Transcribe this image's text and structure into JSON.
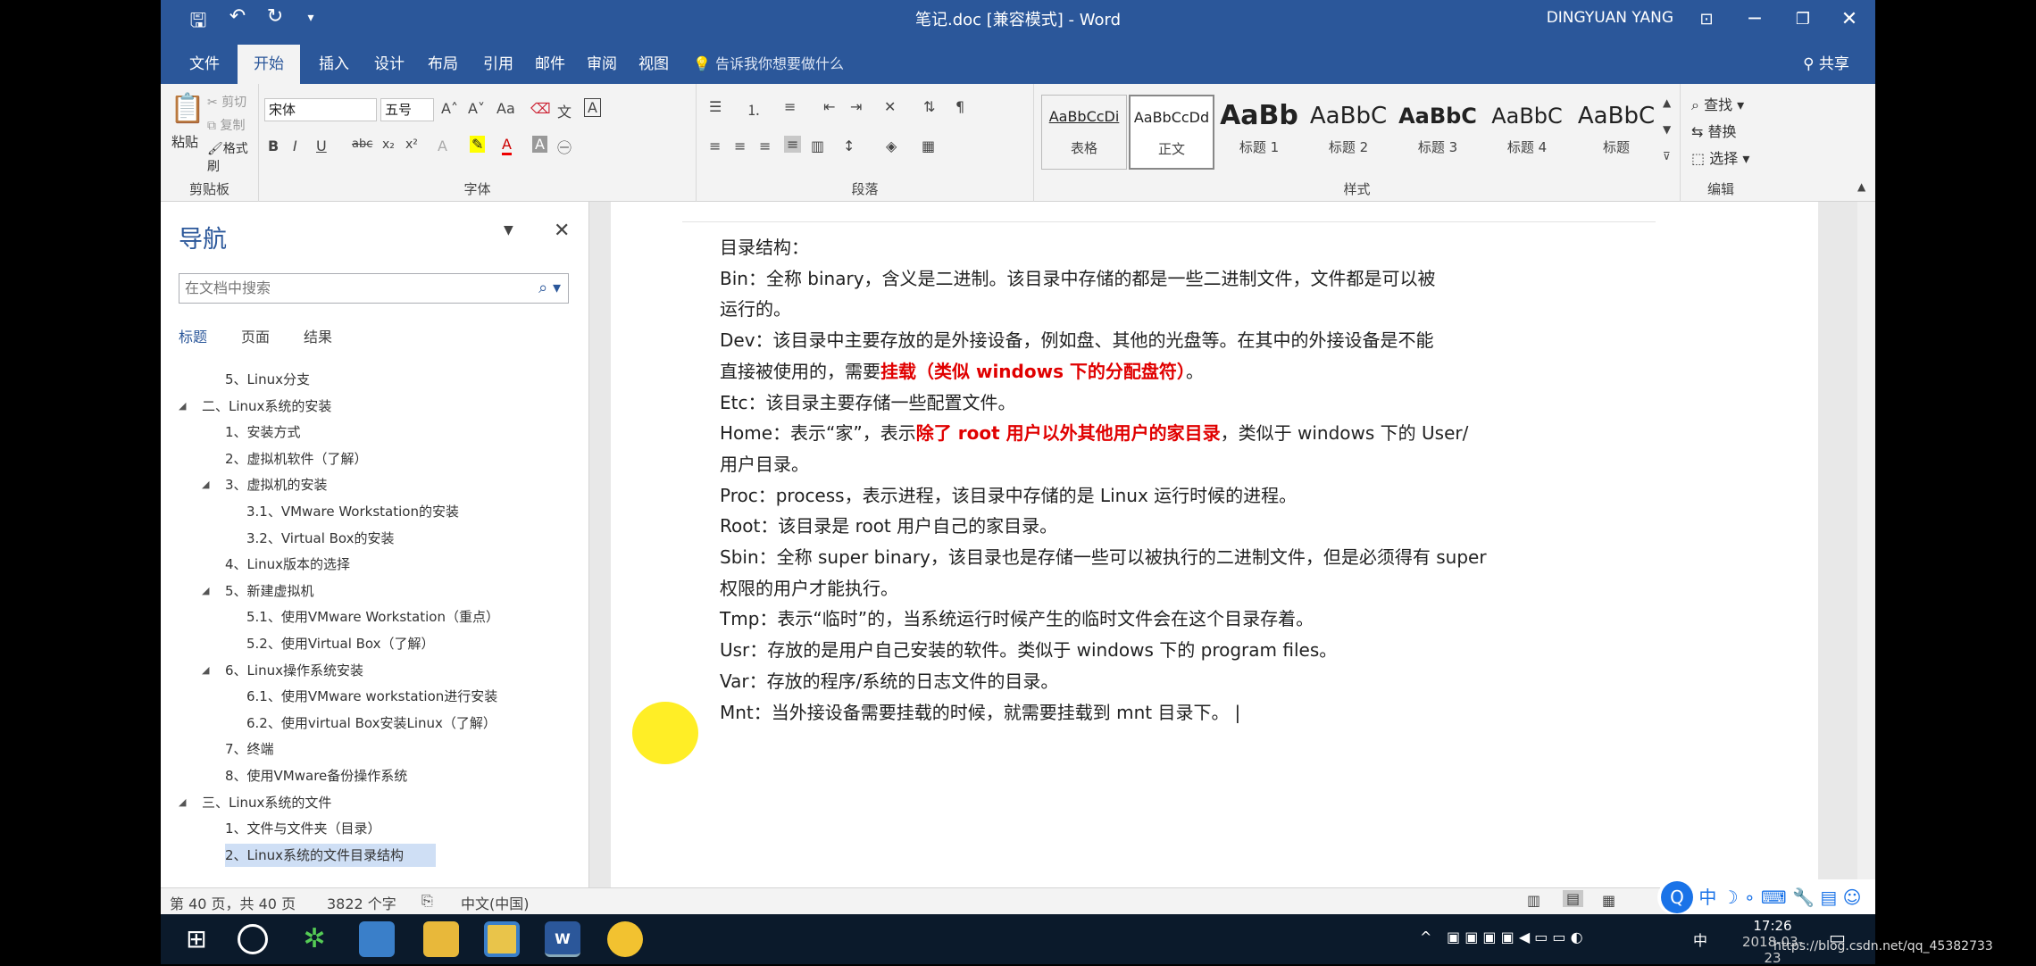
{
  "titlebar": {
    "title": "笔记.doc [兼容模式]  -  Word",
    "user": "DINGYUAN YANG",
    "qat": {
      "save_icon": "save-icon",
      "undo_icon": "undo-icon",
      "redo_icon": "redo-icon"
    }
  },
  "tabs": [
    "文件",
    "开始",
    "插入",
    "设计",
    "布局",
    "引用",
    "邮件",
    "审阅",
    "视图"
  ],
  "tellme": "告诉我你想要做什么",
  "share": "共享",
  "ribbon": {
    "clipboard": {
      "paste": "粘贴",
      "cut": "剪切",
      "copy": "复制",
      "format_painter": "格式刷",
      "label": "剪贴板"
    },
    "font": {
      "name": "宋体",
      "size": "五号",
      "label": "字体",
      "aa": "Aa"
    },
    "paragraph": {
      "label": "段落"
    },
    "styles": {
      "label": "样式",
      "items": [
        {
          "preview": "AaBbCcDi",
          "name": "表格"
        },
        {
          "preview": "AaBbCcDd",
          "name": "正文"
        },
        {
          "preview": "AaBb",
          "name": "标题 1"
        },
        {
          "preview": "AaBbC",
          "name": "标题 2"
        },
        {
          "preview": "AaBbC",
          "name": "标题 3"
        },
        {
          "preview": "AaBbC",
          "name": "标题 4"
        },
        {
          "preview": "AaBbC",
          "name": "标题"
        }
      ]
    },
    "editing": {
      "find": "查找",
      "replace": "替换",
      "select": "选择",
      "label": "编辑"
    }
  },
  "nav": {
    "title": "导航",
    "search_placeholder": "在文档中搜索",
    "tabs": [
      "标题",
      "页面",
      "结果"
    ],
    "items": [
      {
        "text": "5、Linux分支",
        "level": 2,
        "expanded": null
      },
      {
        "text": "二、Linux系统的安装",
        "level": 1,
        "expanded": true
      },
      {
        "text": "1、安装方式",
        "level": 2,
        "expanded": null
      },
      {
        "text": "2、虚拟机软件（了解）",
        "level": 2,
        "expanded": null
      },
      {
        "text": "3、虚拟机的安装",
        "level": 2,
        "expanded": true
      },
      {
        "text": "3.1、VMware Workstation的安装",
        "level": 3,
        "expanded": null
      },
      {
        "text": "3.2、Virtual Box的安装",
        "level": 3,
        "expanded": null
      },
      {
        "text": "4、Linux版本的选择",
        "level": 2,
        "expanded": null
      },
      {
        "text": "5、新建虚拟机",
        "level": 2,
        "expanded": true
      },
      {
        "text": "5.1、使用VMware Workstation（重点）",
        "level": 3,
        "expanded": null
      },
      {
        "text": "5.2、使用Virtual Box（了解）",
        "level": 3,
        "expanded": null
      },
      {
        "text": "6、Linux操作系统安装",
        "level": 2,
        "expanded": true
      },
      {
        "text": "6.1、使用VMware workstation进行安装",
        "level": 3,
        "expanded": null
      },
      {
        "text": "6.2、使用virtual Box安装Linux（了解）",
        "level": 3,
        "expanded": null
      },
      {
        "text": "7、终端",
        "level": 2,
        "expanded": null
      },
      {
        "text": "8、使用VMware备份操作系统",
        "level": 2,
        "expanded": null
      },
      {
        "text": "三、Linux系统的文件",
        "level": 1,
        "expanded": true
      },
      {
        "text": "1、文件与文件夹（目录）",
        "level": 2,
        "expanded": null
      },
      {
        "text": "2、Linux系统的文件目录结构",
        "level": 2,
        "expanded": null,
        "selected": true
      }
    ]
  },
  "document": {
    "lines": [
      [
        {
          "t": "目录结构："
        }
      ],
      [
        {
          "t": "Bin：全称 binary，含义是二进制。该目录中存储的都是一些二进制文件，文件都是可以被"
        }
      ],
      [
        {
          "t": "运行的。"
        }
      ],
      [
        {
          "t": "Dev：该目录中主要存放的是外接设备，例如盘、其他的光盘等。在其中的外接设备是不能"
        }
      ],
      [
        {
          "t": "直接被使用的，需要"
        },
        {
          "t": "挂载（类似 windows 下的分配盘符）",
          "red": true
        },
        {
          "t": "。"
        }
      ],
      [
        {
          "t": "Etc：该目录主要存储一些配置文件。"
        }
      ],
      [
        {
          "t": "Home：表示“家”，表示"
        },
        {
          "t": "除了 root 用户以外其他用户的家目录",
          "red": true
        },
        {
          "t": "，类似于 windows 下的 User/"
        }
      ],
      [
        {
          "t": "用户目录。"
        }
      ],
      [
        {
          "t": "Proc：process，表示进程，该目录中存储的是 Linux 运行时候的进程。"
        }
      ],
      [
        {
          "t": "Root：该目录是 root 用户自己的家目录。"
        }
      ],
      [
        {
          "t": "Sbin：全称 super binary，该目录也是存储一些可以被执行的二进制文件，但是必须得有 super"
        }
      ],
      [
        {
          "t": "权限的用户才能执行。"
        }
      ],
      [
        {
          "t": "Tmp：表示“临时”的，当系统运行时候产生的临时文件会在这个目录存着。"
        }
      ],
      [
        {
          "t": "Usr：存放的是用户自己安装的软件。类似于 windows 下的 program files。"
        }
      ],
      [
        {
          "t": "Var：存放的程序/系统的日志文件的目录。"
        }
      ],
      [
        {
          "t": "Mnt：当外接设备需要挂载的时候，就需要挂载到 mnt 目录下。"
        }
      ]
    ]
  },
  "status": {
    "page": "第 40 页，共 40 页",
    "words": "3822 个字",
    "lang": "中文(中国)"
  },
  "taskbar": {
    "time": "17:26",
    "date": "2018-03-23",
    "ime": "中",
    "watermark": "https://blog.csdn.net/qq_45382733"
  }
}
